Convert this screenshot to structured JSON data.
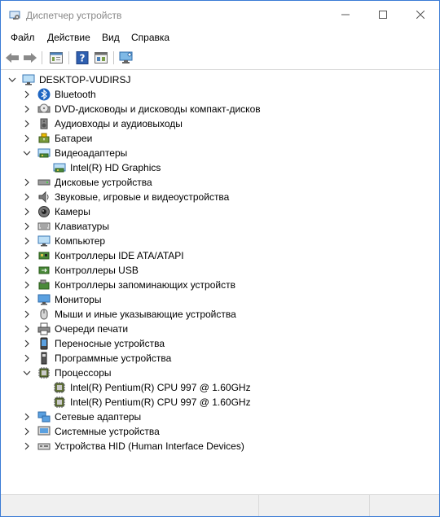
{
  "window": {
    "title": "Диспетчер устройств",
    "icon": "device-manager-icon"
  },
  "menu": [
    "Файл",
    "Действие",
    "Вид",
    "Справка"
  ],
  "toolbar": [
    "back-icon",
    "forward-icon",
    "properties-icon",
    "help-icon",
    "show-hidden-icon",
    "scan-hardware-icon"
  ],
  "tree": {
    "root": "DESKTOP-VUDIRSJ",
    "categories": [
      {
        "label": "Bluetooth",
        "icon": "bluetooth-icon",
        "expanded": false
      },
      {
        "label": "DVD-дисководы и дисководы компакт-дисков",
        "icon": "dvd-drive-icon",
        "expanded": false
      },
      {
        "label": "Аудиовходы и аудиовыходы",
        "icon": "speaker-icon",
        "expanded": false
      },
      {
        "label": "Батареи",
        "icon": "battery-icon",
        "expanded": false
      },
      {
        "label": "Видеоадаптеры",
        "icon": "display-adapter-icon",
        "expanded": true,
        "children": [
          {
            "label": "Intel(R) HD Graphics",
            "icon": "display-adapter-icon"
          }
        ]
      },
      {
        "label": "Дисковые устройства",
        "icon": "disk-drive-icon",
        "expanded": false
      },
      {
        "label": "Звуковые, игровые и видеоустройства",
        "icon": "sound-icon",
        "expanded": false
      },
      {
        "label": "Камеры",
        "icon": "camera-icon",
        "expanded": false
      },
      {
        "label": "Клавиатуры",
        "icon": "keyboard-icon",
        "expanded": false
      },
      {
        "label": "Компьютер",
        "icon": "computer-icon",
        "expanded": false
      },
      {
        "label": "Контроллеры IDE ATA/ATAPI",
        "icon": "ide-controller-icon",
        "expanded": false
      },
      {
        "label": "Контроллеры USB",
        "icon": "usb-controller-icon",
        "expanded": false
      },
      {
        "label": "Контроллеры запоминающих устройств",
        "icon": "storage-controller-icon",
        "expanded": false
      },
      {
        "label": "Мониторы",
        "icon": "monitor-icon",
        "expanded": false
      },
      {
        "label": "Мыши и иные указывающие устройства",
        "icon": "mouse-icon",
        "expanded": false
      },
      {
        "label": "Очереди печати",
        "icon": "printer-icon",
        "expanded": false
      },
      {
        "label": "Переносные устройства",
        "icon": "portable-device-icon",
        "expanded": false
      },
      {
        "label": "Программные устройства",
        "icon": "software-device-icon",
        "expanded": false
      },
      {
        "label": "Процессоры",
        "icon": "processor-icon",
        "expanded": true,
        "children": [
          {
            "label": "Intel(R) Pentium(R) CPU 997 @ 1.60GHz",
            "icon": "processor-icon"
          },
          {
            "label": "Intel(R) Pentium(R) CPU 997 @ 1.60GHz",
            "icon": "processor-icon"
          }
        ]
      },
      {
        "label": "Сетевые адаптеры",
        "icon": "network-adapter-icon",
        "expanded": false
      },
      {
        "label": "Системные устройства",
        "icon": "system-device-icon",
        "expanded": false
      },
      {
        "label": "Устройства HID (Human Interface Devices)",
        "icon": "hid-icon",
        "expanded": false
      }
    ]
  }
}
